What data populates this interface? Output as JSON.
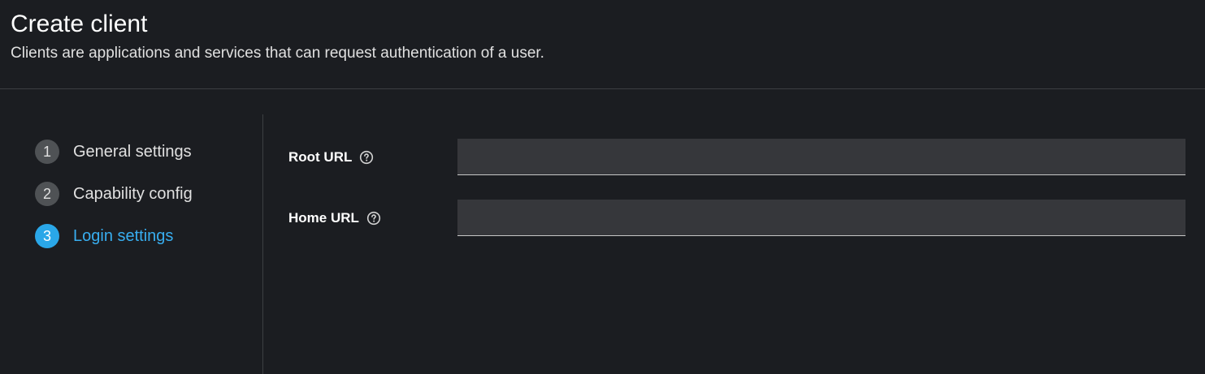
{
  "header": {
    "title": "Create client",
    "description": "Clients are applications and services that can request authentication of a user."
  },
  "wizard": {
    "steps": [
      {
        "number": "1",
        "label": "General settings",
        "current": false
      },
      {
        "number": "2",
        "label": "Capability config",
        "current": false
      },
      {
        "number": "3",
        "label": "Login settings",
        "current": true
      }
    ],
    "current_color": "#2aa7e8"
  },
  "form": {
    "root_url": {
      "label": "Root URL",
      "value": "",
      "icon": "help-icon"
    },
    "home_url": {
      "label": "Home URL",
      "value": "",
      "icon": "help-icon"
    }
  }
}
